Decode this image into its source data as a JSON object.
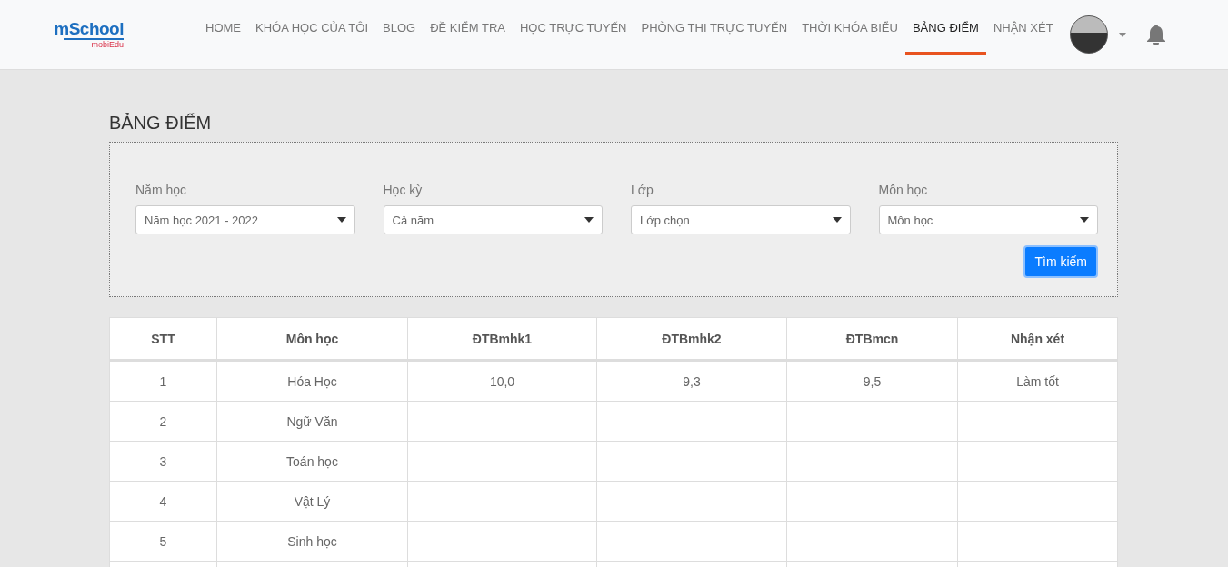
{
  "logo": {
    "main": "mSchool",
    "sub": "mobiEdu"
  },
  "nav": [
    {
      "label": "HOME",
      "selected": false
    },
    {
      "label": "KHÓA HỌC CỦA TÔI",
      "selected": false
    },
    {
      "label": "BLOG",
      "selected": false
    },
    {
      "label": "ĐỀ KIỂM TRA",
      "selected": false
    },
    {
      "label": "HỌC TRỰC TUYẾN",
      "selected": false
    },
    {
      "label": "PHÒNG THI TRỰC TUYẾN",
      "selected": false
    },
    {
      "label": "THỜI KHÓA BIỂU",
      "selected": false
    },
    {
      "label": "BẢNG ĐIỂM",
      "selected": true
    },
    {
      "label": "NHẬN XÉT",
      "selected": false
    }
  ],
  "page_title": "BẢNG ĐIỂM",
  "filters": [
    {
      "label": "Năm học",
      "value": "Năm học 2021 - 2022"
    },
    {
      "label": "Học kỳ",
      "value": "Cả năm"
    },
    {
      "label": "Lớp",
      "value": "Lớp chọn"
    },
    {
      "label": "Môn học",
      "value": "Môn học"
    }
  ],
  "search_button": "Tìm kiếm",
  "table": {
    "columns": [
      "STT",
      "Môn học",
      "ĐTBmhk1",
      "ĐTBmhk2",
      "ĐTBmcn",
      "Nhận xét"
    ],
    "rows": [
      [
        "1",
        "Hóa Học",
        "10,0",
        "9,3",
        "9,5",
        "Làm tốt"
      ],
      [
        "2",
        "Ngữ Văn",
        "",
        "",
        "",
        ""
      ],
      [
        "3",
        "Toán học",
        "",
        "",
        "",
        ""
      ],
      [
        "4",
        "Vật Lý",
        "",
        "",
        "",
        ""
      ],
      [
        "5",
        "Sinh học",
        "",
        "",
        "",
        ""
      ],
      [
        "",
        "",
        "",
        "",
        "",
        ""
      ]
    ]
  }
}
